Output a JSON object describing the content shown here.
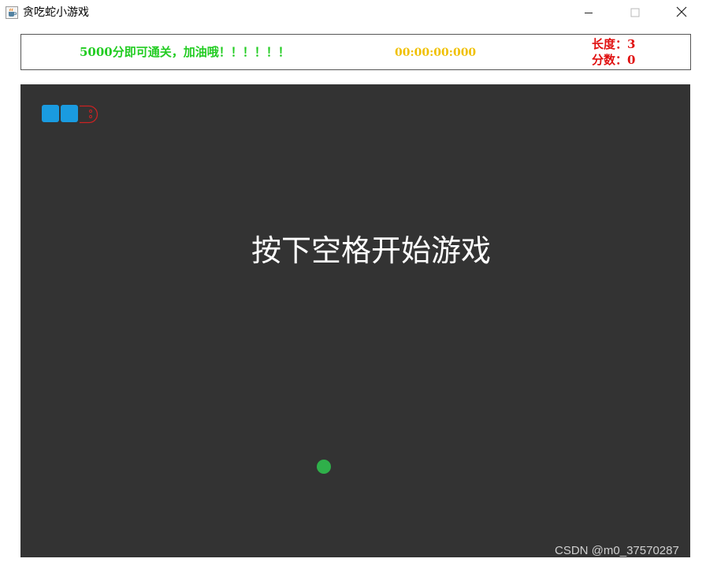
{
  "window": {
    "title": "贪吃蛇小游戏",
    "icon": "java-cup-icon",
    "controls": [
      "minimize-icon",
      "maximize-icon",
      "close-icon"
    ]
  },
  "info": {
    "goal": "5000分即可通关，加油哦！！！！！！",
    "timer": "00:00:00:000",
    "length": "长度：3",
    "score": "分数：0"
  },
  "board": {
    "prompt": "按下空格开始游戏",
    "snake_length": 3,
    "colors": {
      "board": "#333333",
      "snake_body": "#1a9be0",
      "snake_head_outline": "#cc2222",
      "food": "#2fb04a",
      "goal_text": "#22cc22",
      "timer_text": "#f0c000",
      "stats_text": "#e01010"
    }
  },
  "watermark": "CSDN @m0_37570287"
}
